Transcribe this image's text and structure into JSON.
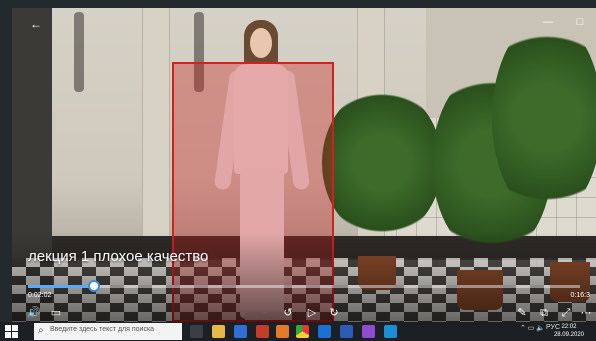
{
  "window": {
    "back_icon": "back-arrow-icon",
    "minimize": "—",
    "maximize": "□"
  },
  "video": {
    "title": "лекция  1 плохое качество",
    "progress": 0.12,
    "time_current": "0:02:02",
    "time_total": "0:16:3"
  },
  "controls": {
    "volume": "volume-icon",
    "subtitles": "subtitles-icon",
    "rewind": "rewind-10-icon",
    "play": "play-icon",
    "forward": "forward-30-icon",
    "edit": "pen-icon",
    "miniview": "mini-view-icon",
    "fullscreen": "fullscreen-icon",
    "more": "more-icon"
  },
  "taskbar": {
    "search_placeholder": "Введите здесь текст для поиска",
    "language": "РУС",
    "time": "22:02",
    "date": "28.09.2020"
  }
}
